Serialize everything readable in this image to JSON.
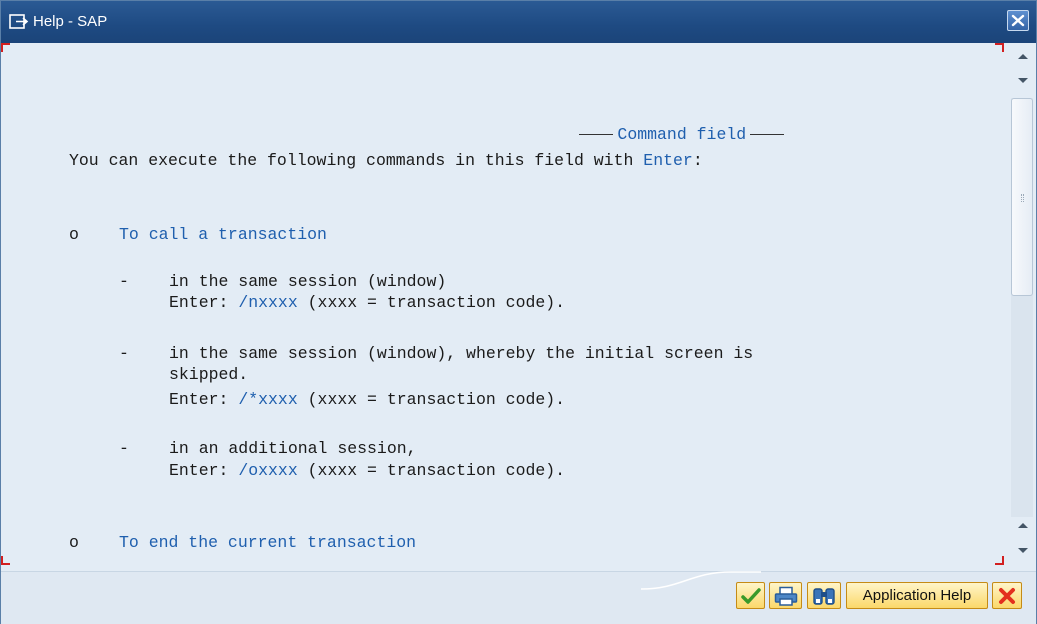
{
  "window": {
    "title": "Help - SAP"
  },
  "doc": {
    "heading": "Command field",
    "intro_pre": "You can execute the following commands in this field with ",
    "intro_link": "Enter",
    "intro_post": ":",
    "section1": {
      "bullet": "o",
      "title": "To call a transaction",
      "items": [
        {
          "dash": "-",
          "line1": "in the same session (window)",
          "enter_label": "Enter: ",
          "code": "/nxxxx",
          "rest": " (xxxx = transaction code)."
        },
        {
          "dash": "-",
          "line1": "in the same session (window), whereby the initial screen is",
          "line2": "skipped.",
          "enter_label": "Enter: ",
          "code": "/*xxxx",
          "rest": " (xxxx = transaction code)."
        },
        {
          "dash": "-",
          "line1": "in an additional session,",
          "enter_label": "Enter: ",
          "code": "/oxxxx",
          "rest": " (xxxx = transaction code)."
        }
      ]
    },
    "section2": {
      "bullet": "o",
      "title": "To end the current transaction"
    }
  },
  "footer": {
    "app_help_label": "Application Help"
  },
  "icons": {
    "window": "help-window-icon",
    "close": "close-icon",
    "ok": "checkmark-icon",
    "print": "printer-icon",
    "find": "binoculars-icon",
    "cancel": "cancel-icon"
  },
  "colors": {
    "titlebar": "#1e4a82",
    "link": "#1f5fae",
    "content_bg": "#e3ecf5",
    "button_bg": "#fbd86a",
    "cancel_red": "#e3301e"
  }
}
